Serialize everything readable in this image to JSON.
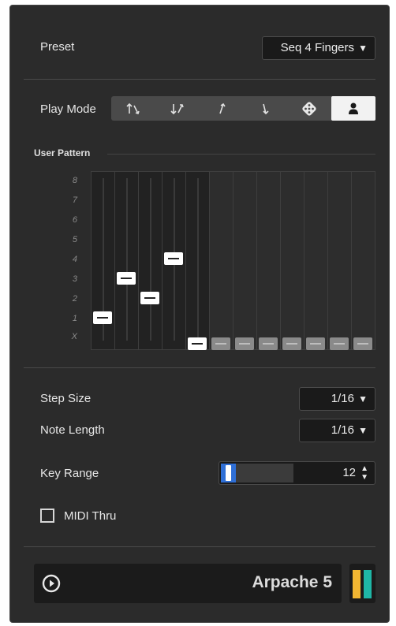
{
  "preset": {
    "label": "Preset",
    "value": "Seq 4 Fingers"
  },
  "play_mode": {
    "label": "Play Mode",
    "buttons": [
      {
        "name": "up-down",
        "glyph": "↑↓"
      },
      {
        "name": "down-up",
        "glyph": "↓↑"
      },
      {
        "name": "up",
        "glyph": "↑"
      },
      {
        "name": "down",
        "glyph": "↓"
      },
      {
        "name": "random",
        "glyph": "⚄"
      },
      {
        "name": "user",
        "glyph": "●"
      }
    ],
    "active": "user"
  },
  "user_pattern": {
    "label": "User Pattern",
    "y_labels": [
      "8",
      "7",
      "6",
      "5",
      "4",
      "3",
      "2",
      "1",
      "X"
    ],
    "steps": [
      "1",
      "3",
      "2",
      "4",
      "X",
      "X",
      "X",
      "X",
      "X",
      "X",
      "X",
      "X"
    ],
    "active_steps": 5
  },
  "step_size": {
    "label": "Step Size",
    "value": "1/16"
  },
  "note_length": {
    "label": "Note Length",
    "value": "1/16"
  },
  "key_range": {
    "label": "Key Range",
    "value": "12"
  },
  "midi_thru": {
    "label": "MIDI Thru",
    "checked": false
  },
  "footer": {
    "title": "Arpache 5"
  },
  "colors": {
    "meter_left": "#f2b632",
    "meter_right": "#1fb7a6",
    "accent": "#2f6fd6"
  }
}
